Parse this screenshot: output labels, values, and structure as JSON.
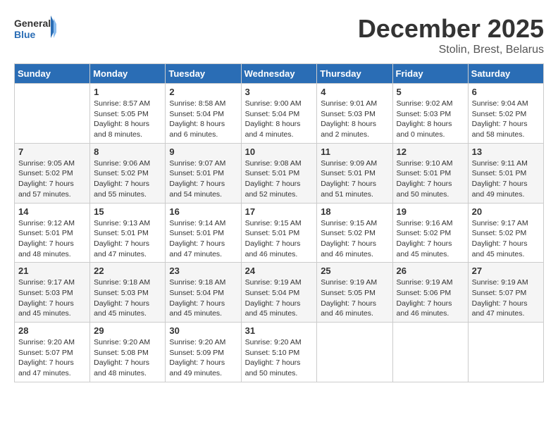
{
  "logo": {
    "line1": "General",
    "line2": "Blue"
  },
  "title": "December 2025",
  "subtitle": "Stolin, Brest, Belarus",
  "weekdays": [
    "Sunday",
    "Monday",
    "Tuesday",
    "Wednesday",
    "Thursday",
    "Friday",
    "Saturday"
  ],
  "weeks": [
    [
      null,
      {
        "day": "1",
        "sunrise": "8:57 AM",
        "sunset": "5:05 PM",
        "daylight": "8 hours and 8 minutes."
      },
      {
        "day": "2",
        "sunrise": "8:58 AM",
        "sunset": "5:04 PM",
        "daylight": "8 hours and 6 minutes."
      },
      {
        "day": "3",
        "sunrise": "9:00 AM",
        "sunset": "5:04 PM",
        "daylight": "8 hours and 4 minutes."
      },
      {
        "day": "4",
        "sunrise": "9:01 AM",
        "sunset": "5:03 PM",
        "daylight": "8 hours and 2 minutes."
      },
      {
        "day": "5",
        "sunrise": "9:02 AM",
        "sunset": "5:03 PM",
        "daylight": "8 hours and 0 minutes."
      },
      {
        "day": "6",
        "sunrise": "9:04 AM",
        "sunset": "5:02 PM",
        "daylight": "7 hours and 58 minutes."
      }
    ],
    [
      {
        "day": "7",
        "sunrise": "9:05 AM",
        "sunset": "5:02 PM",
        "daylight": "7 hours and 57 minutes."
      },
      {
        "day": "8",
        "sunrise": "9:06 AM",
        "sunset": "5:02 PM",
        "daylight": "7 hours and 55 minutes."
      },
      {
        "day": "9",
        "sunrise": "9:07 AM",
        "sunset": "5:01 PM",
        "daylight": "7 hours and 54 minutes."
      },
      {
        "day": "10",
        "sunrise": "9:08 AM",
        "sunset": "5:01 PM",
        "daylight": "7 hours and 52 minutes."
      },
      {
        "day": "11",
        "sunrise": "9:09 AM",
        "sunset": "5:01 PM",
        "daylight": "7 hours and 51 minutes."
      },
      {
        "day": "12",
        "sunrise": "9:10 AM",
        "sunset": "5:01 PM",
        "daylight": "7 hours and 50 minutes."
      },
      {
        "day": "13",
        "sunrise": "9:11 AM",
        "sunset": "5:01 PM",
        "daylight": "7 hours and 49 minutes."
      }
    ],
    [
      {
        "day": "14",
        "sunrise": "9:12 AM",
        "sunset": "5:01 PM",
        "daylight": "7 hours and 48 minutes."
      },
      {
        "day": "15",
        "sunrise": "9:13 AM",
        "sunset": "5:01 PM",
        "daylight": "7 hours and 47 minutes."
      },
      {
        "day": "16",
        "sunrise": "9:14 AM",
        "sunset": "5:01 PM",
        "daylight": "7 hours and 47 minutes."
      },
      {
        "day": "17",
        "sunrise": "9:15 AM",
        "sunset": "5:01 PM",
        "daylight": "7 hours and 46 minutes."
      },
      {
        "day": "18",
        "sunrise": "9:15 AM",
        "sunset": "5:02 PM",
        "daylight": "7 hours and 46 minutes."
      },
      {
        "day": "19",
        "sunrise": "9:16 AM",
        "sunset": "5:02 PM",
        "daylight": "7 hours and 45 minutes."
      },
      {
        "day": "20",
        "sunrise": "9:17 AM",
        "sunset": "5:02 PM",
        "daylight": "7 hours and 45 minutes."
      }
    ],
    [
      {
        "day": "21",
        "sunrise": "9:17 AM",
        "sunset": "5:03 PM",
        "daylight": "7 hours and 45 minutes."
      },
      {
        "day": "22",
        "sunrise": "9:18 AM",
        "sunset": "5:03 PM",
        "daylight": "7 hours and 45 minutes."
      },
      {
        "day": "23",
        "sunrise": "9:18 AM",
        "sunset": "5:04 PM",
        "daylight": "7 hours and 45 minutes."
      },
      {
        "day": "24",
        "sunrise": "9:19 AM",
        "sunset": "5:04 PM",
        "daylight": "7 hours and 45 minutes."
      },
      {
        "day": "25",
        "sunrise": "9:19 AM",
        "sunset": "5:05 PM",
        "daylight": "7 hours and 46 minutes."
      },
      {
        "day": "26",
        "sunrise": "9:19 AM",
        "sunset": "5:06 PM",
        "daylight": "7 hours and 46 minutes."
      },
      {
        "day": "27",
        "sunrise": "9:19 AM",
        "sunset": "5:07 PM",
        "daylight": "7 hours and 47 minutes."
      }
    ],
    [
      {
        "day": "28",
        "sunrise": "9:20 AM",
        "sunset": "5:07 PM",
        "daylight": "7 hours and 47 minutes."
      },
      {
        "day": "29",
        "sunrise": "9:20 AM",
        "sunset": "5:08 PM",
        "daylight": "7 hours and 48 minutes."
      },
      {
        "day": "30",
        "sunrise": "9:20 AM",
        "sunset": "5:09 PM",
        "daylight": "7 hours and 49 minutes."
      },
      {
        "day": "31",
        "sunrise": "9:20 AM",
        "sunset": "5:10 PM",
        "daylight": "7 hours and 50 minutes."
      },
      null,
      null,
      null
    ]
  ]
}
